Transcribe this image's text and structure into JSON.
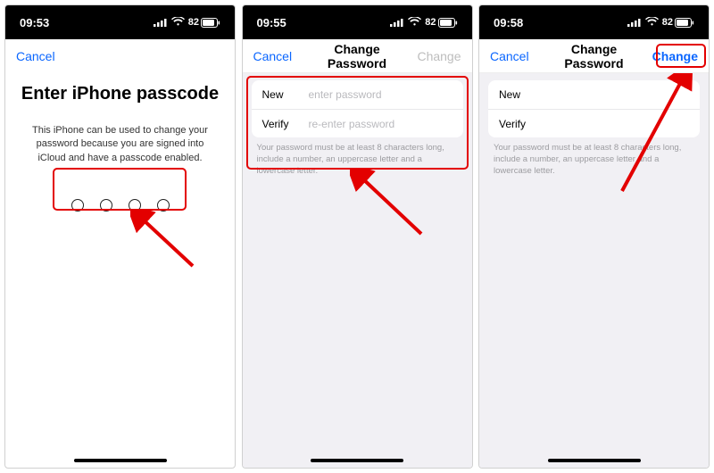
{
  "status": {
    "battery_pct": "82"
  },
  "screens": [
    {
      "time": "09:53",
      "nav_left": "Cancel",
      "heading": "Enter iPhone passcode",
      "desc": "This iPhone can be used to change your password because you are signed into iCloud and have a passcode enabled."
    },
    {
      "time": "09:55",
      "nav_left": "Cancel",
      "nav_title": "Change Password",
      "nav_right": "Change",
      "form": {
        "new_label": "New",
        "new_placeholder": "enter password",
        "verify_label": "Verify",
        "verify_placeholder": "re-enter password"
      },
      "hint": "Your password must be at least 8 characters long, include a number, an uppercase letter and a lowercase letter."
    },
    {
      "time": "09:58",
      "nav_left": "Cancel",
      "nav_title": "Change Password",
      "nav_right": "Change",
      "form": {
        "new_label": "New",
        "verify_label": "Verify"
      },
      "hint": "Your password must be at least 8 characters long, include a number, an uppercase letter and a lowercase letter."
    }
  ]
}
